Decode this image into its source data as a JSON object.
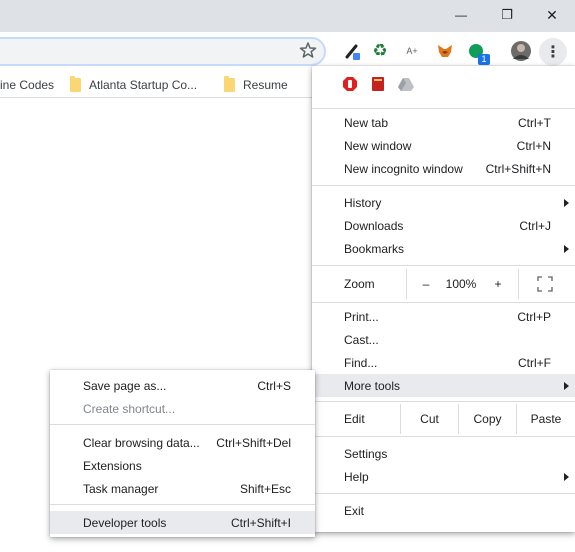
{
  "window": {
    "minimize_glyph": "—",
    "maximize_glyph": "❐",
    "close_glyph": "✕"
  },
  "toolbar": {
    "star_icon": "star-icon",
    "extensions": [
      {
        "name": "eyedropper-extension-icon",
        "glyph": "✎",
        "color": "#202124",
        "badge": ""
      },
      {
        "name": "recycle-extension-icon",
        "glyph": "♻",
        "color": "#1e7e34",
        "badge": ""
      },
      {
        "name": "text-resize-extension-icon",
        "glyph": "A+",
        "color": "#5f6368",
        "badge": ""
      },
      {
        "name": "metamask-extension-icon",
        "glyph": "🦊",
        "color": "#e2761b",
        "badge": ""
      },
      {
        "name": "green-dot-extension-icon",
        "glyph": "●",
        "color": "#0f9d58",
        "badge": "1"
      }
    ],
    "menu_glyph": "⋮"
  },
  "bookmarks": [
    {
      "label": "ine Codes",
      "folder": false
    },
    {
      "label": "Atlanta Startup Co...",
      "folder": true
    },
    {
      "label": "Resume",
      "folder": true
    }
  ],
  "main_menu": {
    "top_icons": [
      {
        "name": "adblock-icon",
        "color": "#e21f1f"
      },
      {
        "name": "book-icon",
        "color": "#c5221f"
      },
      {
        "name": "drive-icon",
        "color": "#9aa0a6"
      }
    ],
    "new_tab": {
      "label": "New tab",
      "shortcut": "Ctrl+T"
    },
    "new_window": {
      "label": "New window",
      "shortcut": "Ctrl+N"
    },
    "new_incognito": {
      "label": "New incognito window",
      "shortcut": "Ctrl+Shift+N"
    },
    "history": {
      "label": "History"
    },
    "downloads": {
      "label": "Downloads",
      "shortcut": "Ctrl+J"
    },
    "bookmarks": {
      "label": "Bookmarks"
    },
    "zoom": {
      "label": "Zoom",
      "minus": "–",
      "value": "100%",
      "plus": "+"
    },
    "print": {
      "label": "Print...",
      "shortcut": "Ctrl+P"
    },
    "cast": {
      "label": "Cast..."
    },
    "find": {
      "label": "Find...",
      "shortcut": "Ctrl+F"
    },
    "more_tools": {
      "label": "More tools"
    },
    "edit": {
      "label": "Edit",
      "cut": "Cut",
      "copy": "Copy",
      "paste": "Paste"
    },
    "settings": {
      "label": "Settings"
    },
    "help": {
      "label": "Help"
    },
    "exit": {
      "label": "Exit"
    }
  },
  "sub_menu": {
    "save_page": {
      "label": "Save page as...",
      "shortcut": "Ctrl+S"
    },
    "create_shortcut": {
      "label": "Create shortcut..."
    },
    "clear_browsing": {
      "label": "Clear browsing data...",
      "shortcut": "Ctrl+Shift+Del"
    },
    "extensions": {
      "label": "Extensions"
    },
    "task_manager": {
      "label": "Task manager",
      "shortcut": "Shift+Esc"
    },
    "developer_tools": {
      "label": "Developer tools",
      "shortcut": "Ctrl+Shift+I"
    }
  }
}
